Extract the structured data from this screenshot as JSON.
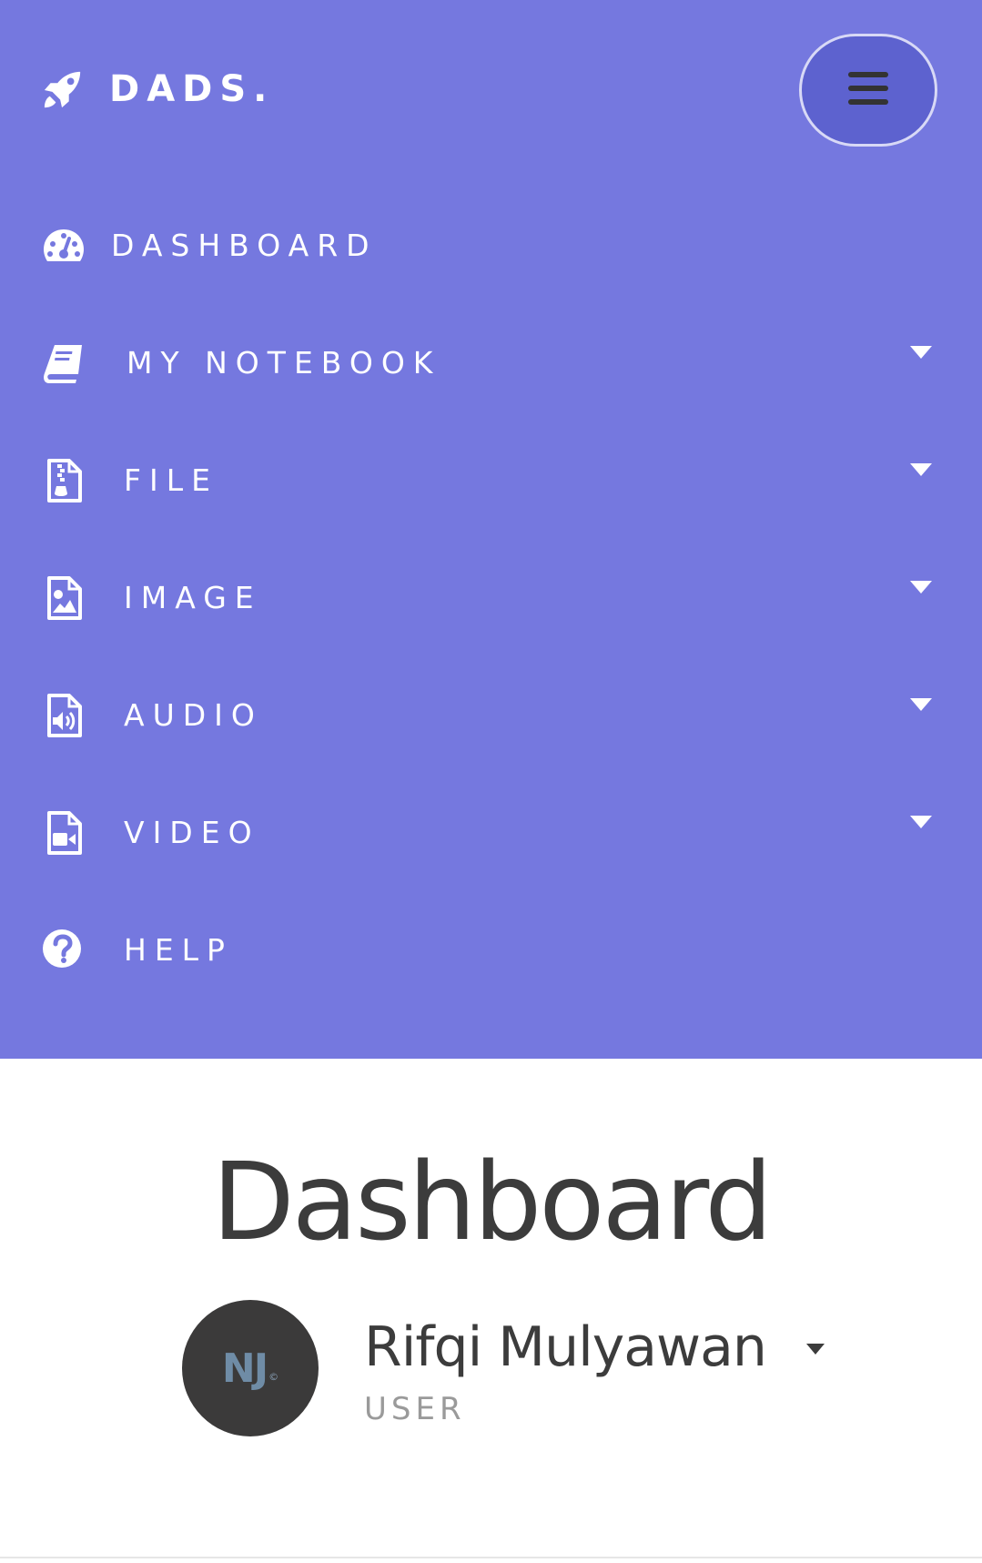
{
  "brand": {
    "name": "DADS.",
    "icon": "rocket-icon"
  },
  "menu_toggle": {
    "icon": "hamburger-icon"
  },
  "colors": {
    "nav_background": "#7578df",
    "toggle_background": "#5d62cf",
    "nav_text": "#ffffff",
    "heading_text": "#3c3c3c",
    "role_text": "#9a9a9a",
    "avatar_background": "#3b3a3a"
  },
  "nav": {
    "items": [
      {
        "label": "DASHBOARD",
        "icon": "dashboard-gauge-icon",
        "has_submenu": false
      },
      {
        "label": "MY NOTEBOOK",
        "icon": "book-icon",
        "has_submenu": true
      },
      {
        "label": "FILE",
        "icon": "file-archive-icon",
        "has_submenu": true
      },
      {
        "label": "IMAGE",
        "icon": "file-image-icon",
        "has_submenu": true
      },
      {
        "label": "AUDIO",
        "icon": "file-audio-icon",
        "has_submenu": true
      },
      {
        "label": "VIDEO",
        "icon": "file-video-icon",
        "has_submenu": true
      },
      {
        "label": "HELP",
        "icon": "question-circle-icon",
        "has_submenu": false
      }
    ]
  },
  "main": {
    "title": "Dashboard",
    "user": {
      "initials": "NJ",
      "avatar_mark": "©",
      "name": "Rifqi Mulyawan",
      "role": "USER"
    }
  }
}
